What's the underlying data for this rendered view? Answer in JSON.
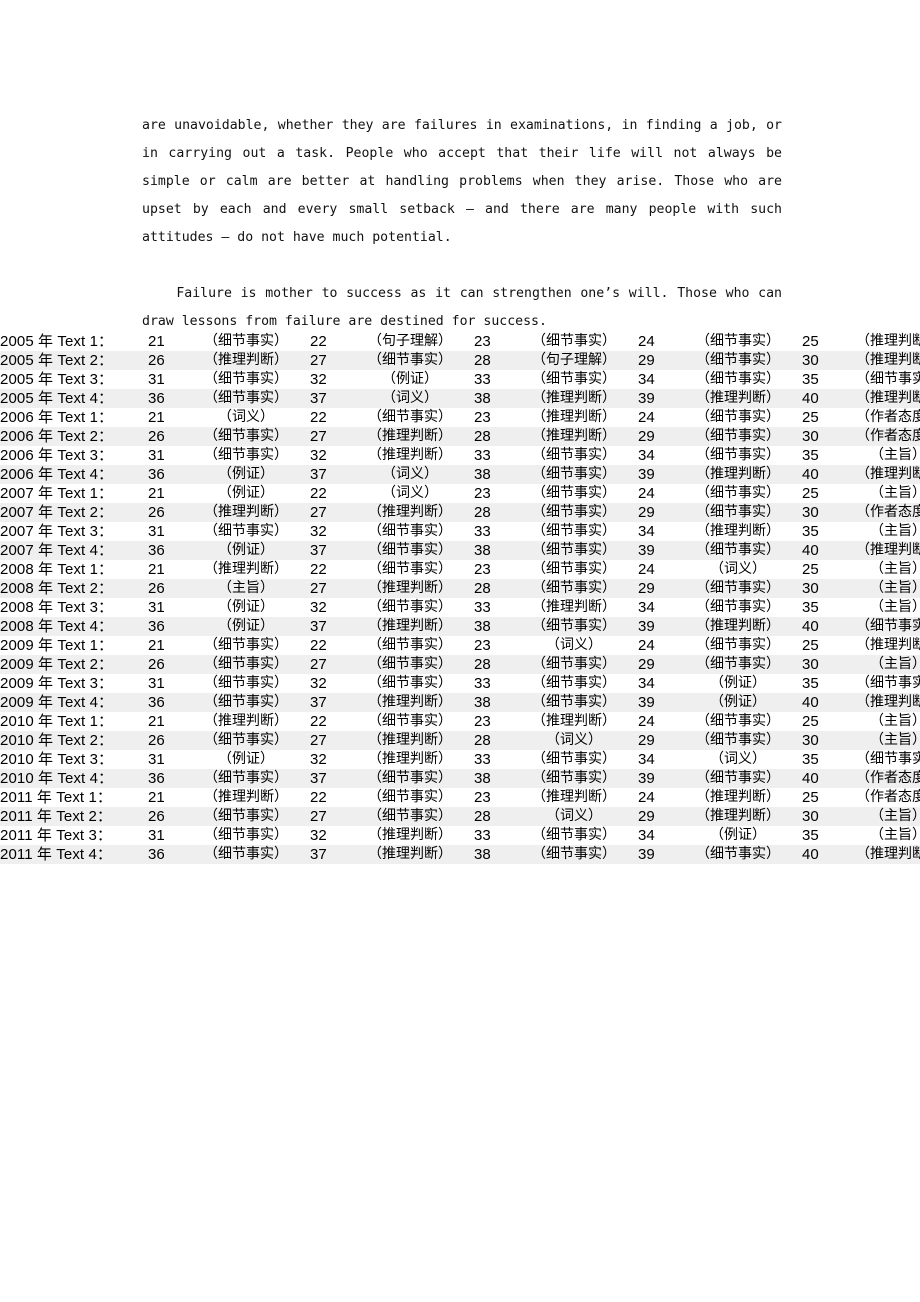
{
  "document": {
    "paragraphs": [
      "are unavoidable, whether they are failures in examinations, in finding a job, or in carrying out a task. People who accept that their life will not always be simple or calm are better at handling problems when they arise. Those who are upset by each and every small setback – and there are many people with such attitudes – do not have much potential.",
      "Failure is mother to success as it can strengthen one’s will. Those who can draw lessons from failure are destined for success."
    ]
  },
  "answer_table": {
    "label_suffix": "：",
    "rows": [
      {
        "label": "2005 年 Text 1：",
        "shaded": false,
        "cells": [
          {
            "num": "21",
            "type": "（细节事实）"
          },
          {
            "num": "22",
            "type": "（句子理解）"
          },
          {
            "num": "23",
            "type": "（细节事实）"
          },
          {
            "num": "24",
            "type": "（细节事实）"
          },
          {
            "num": "25",
            "type": "（推理判断）"
          }
        ]
      },
      {
        "label": "2005 年 Text 2：",
        "shaded": true,
        "cells": [
          {
            "num": "26",
            "type": "（推理判断）"
          },
          {
            "num": "27",
            "type": "（细节事实）"
          },
          {
            "num": "28",
            "type": "（句子理解）"
          },
          {
            "num": "29",
            "type": "（细节事实）"
          },
          {
            "num": "30",
            "type": "（推理判断）"
          }
        ]
      },
      {
        "label": "2005 年 Text 3：",
        "shaded": false,
        "cells": [
          {
            "num": "31",
            "type": "（细节事实）"
          },
          {
            "num": "32",
            "type": "（例证）"
          },
          {
            "num": "33",
            "type": "（细节事实）"
          },
          {
            "num": "34",
            "type": "（细节事实）"
          },
          {
            "num": "35",
            "type": "（细节事实）"
          }
        ]
      },
      {
        "label": "2005 年 Text 4：",
        "shaded": true,
        "cells": [
          {
            "num": "36",
            "type": "（细节事实）"
          },
          {
            "num": "37",
            "type": "（词义）"
          },
          {
            "num": "38",
            "type": "（推理判断）"
          },
          {
            "num": "39",
            "type": "（推理判断）"
          },
          {
            "num": "40",
            "type": "（推理判断）"
          }
        ]
      },
      {
        "label": "2006 年 Text 1：",
        "shaded": false,
        "cells": [
          {
            "num": "21",
            "type": "（词义）"
          },
          {
            "num": "22",
            "type": "（细节事实）"
          },
          {
            "num": "23",
            "type": "（推理判断）"
          },
          {
            "num": "24",
            "type": "（细节事实）"
          },
          {
            "num": "25",
            "type": "（作者态度）"
          }
        ]
      },
      {
        "label": "2006 年 Text 2：",
        "shaded": true,
        "cells": [
          {
            "num": "26",
            "type": "（细节事实）"
          },
          {
            "num": "27",
            "type": "（推理判断）"
          },
          {
            "num": "28",
            "type": "（推理判断）"
          },
          {
            "num": "29",
            "type": "（细节事实）"
          },
          {
            "num": "30",
            "type": "（作者态度）"
          }
        ]
      },
      {
        "label": "2006 年 Text 3：",
        "shaded": false,
        "cells": [
          {
            "num": "31",
            "type": "（细节事实）"
          },
          {
            "num": "32",
            "type": "（推理判断）"
          },
          {
            "num": "33",
            "type": "（细节事实）"
          },
          {
            "num": "34",
            "type": "（细节事实）"
          },
          {
            "num": "35",
            "type": "（主旨）"
          }
        ]
      },
      {
        "label": "2006 年 Text 4：",
        "shaded": true,
        "cells": [
          {
            "num": "36",
            "type": "（例证）"
          },
          {
            "num": "37",
            "type": "（词义）"
          },
          {
            "num": "38",
            "type": "（细节事实）"
          },
          {
            "num": "39",
            "type": "（推理判断）"
          },
          {
            "num": "40",
            "type": "（推理判断）"
          }
        ]
      },
      {
        "label": "2007 年 Text 1：",
        "shaded": false,
        "cells": [
          {
            "num": "21",
            "type": "（例证）"
          },
          {
            "num": "22",
            "type": "（词义）"
          },
          {
            "num": "23",
            "type": "（细节事实）"
          },
          {
            "num": "24",
            "type": "（细节事实）"
          },
          {
            "num": "25",
            "type": "（主旨）"
          }
        ]
      },
      {
        "label": "2007 年 Text 2：",
        "shaded": true,
        "cells": [
          {
            "num": "26",
            "type": "（推理判断）"
          },
          {
            "num": "27",
            "type": "（推理判断）"
          },
          {
            "num": "28",
            "type": "（细节事实）"
          },
          {
            "num": "29",
            "type": "（细节事实）"
          },
          {
            "num": "30",
            "type": "（作者态度）"
          }
        ]
      },
      {
        "label": "2007 年 Text 3：",
        "shaded": false,
        "cells": [
          {
            "num": "31",
            "type": "（细节事实）"
          },
          {
            "num": "32",
            "type": "（细节事实）"
          },
          {
            "num": "33",
            "type": "（细节事实）"
          },
          {
            "num": "34",
            "type": "（推理判断）"
          },
          {
            "num": "35",
            "type": "（主旨）"
          }
        ]
      },
      {
        "label": "2007 年 Text 4：",
        "shaded": true,
        "cells": [
          {
            "num": "36",
            "type": "（例证）"
          },
          {
            "num": "37",
            "type": "（细节事实）"
          },
          {
            "num": "38",
            "type": "（细节事实）"
          },
          {
            "num": "39",
            "type": "（细节事实）"
          },
          {
            "num": "40",
            "type": "（推理判断）"
          }
        ]
      },
      {
        "label": "2008 年 Text 1：",
        "shaded": false,
        "cells": [
          {
            "num": "21",
            "type": "（推理判断）"
          },
          {
            "num": "22",
            "type": "（细节事实）"
          },
          {
            "num": "23",
            "type": "（细节事实）"
          },
          {
            "num": "24",
            "type": "（词义）"
          },
          {
            "num": "25",
            "type": "（主旨）"
          }
        ]
      },
      {
        "label": "2008 年 Text 2：",
        "shaded": true,
        "cells": [
          {
            "num": "26",
            "type": "（主旨）"
          },
          {
            "num": "27",
            "type": "（推理判断）"
          },
          {
            "num": "28",
            "type": "（细节事实）"
          },
          {
            "num": "29",
            "type": "（细节事实）"
          },
          {
            "num": "30",
            "type": "（主旨）"
          }
        ]
      },
      {
        "label": "2008 年 Text 3：",
        "shaded": false,
        "cells": [
          {
            "num": "31",
            "type": "（例证）"
          },
          {
            "num": "32",
            "type": "（细节事实）"
          },
          {
            "num": "33",
            "type": "（推理判断）"
          },
          {
            "num": "34",
            "type": "（细节事实）"
          },
          {
            "num": "35",
            "type": "（主旨）"
          }
        ]
      },
      {
        "label": "2008 年 Text 4：",
        "shaded": true,
        "cells": [
          {
            "num": "36",
            "type": "（例证）"
          },
          {
            "num": "37",
            "type": "（推理判断）"
          },
          {
            "num": "38",
            "type": "（细节事实）"
          },
          {
            "num": "39",
            "type": "（推理判断）"
          },
          {
            "num": "40",
            "type": "（细节事实）"
          }
        ]
      },
      {
        "label": "2009 年 Text 1：",
        "shaded": false,
        "cells": [
          {
            "num": "21",
            "type": "（细节事实）"
          },
          {
            "num": "22",
            "type": "（细节事实）"
          },
          {
            "num": "23",
            "type": "（词义）"
          },
          {
            "num": "24",
            "type": "（细节事实）"
          },
          {
            "num": "25",
            "type": "（推理判断）"
          }
        ]
      },
      {
        "label": "2009 年 Text 2：",
        "shaded": true,
        "cells": [
          {
            "num": "26",
            "type": "（细节事实）"
          },
          {
            "num": "27",
            "type": "（细节事实）"
          },
          {
            "num": "28",
            "type": "（细节事实）"
          },
          {
            "num": "29",
            "type": "（细节事实）"
          },
          {
            "num": "30",
            "type": "（主旨）"
          }
        ]
      },
      {
        "label": "2009 年 Text 3：",
        "shaded": false,
        "cells": [
          {
            "num": "31",
            "type": "（细节事实）"
          },
          {
            "num": "32",
            "type": "（细节事实）"
          },
          {
            "num": "33",
            "type": "（细节事实）"
          },
          {
            "num": "34",
            "type": "（例证）"
          },
          {
            "num": "35",
            "type": "（细节事实）"
          }
        ]
      },
      {
        "label": "2009 年 Text 4：",
        "shaded": true,
        "cells": [
          {
            "num": "36",
            "type": "（细节事实）"
          },
          {
            "num": "37",
            "type": "（推理判断）"
          },
          {
            "num": "38",
            "type": "（细节事实）"
          },
          {
            "num": "39",
            "type": "（例证）"
          },
          {
            "num": "40",
            "type": "（推理判断）"
          }
        ]
      },
      {
        "label": "2010 年 Text 1：",
        "shaded": false,
        "cells": [
          {
            "num": "21",
            "type": "（推理判断）"
          },
          {
            "num": "22",
            "type": "（细节事实）"
          },
          {
            "num": "23",
            "type": "（推理判断）"
          },
          {
            "num": "24",
            "type": "（细节事实）"
          },
          {
            "num": "25",
            "type": "（主旨）"
          }
        ]
      },
      {
        "label": "2010 年 Text 2：",
        "shaded": true,
        "cells": [
          {
            "num": "26",
            "type": "（细节事实）"
          },
          {
            "num": "27",
            "type": "（推理判断）"
          },
          {
            "num": "28",
            "type": "（词义）"
          },
          {
            "num": "29",
            "type": "（细节事实）"
          },
          {
            "num": "30",
            "type": "（主旨）"
          }
        ]
      },
      {
        "label": "2010 年 Text 3：",
        "shaded": false,
        "cells": [
          {
            "num": "31",
            "type": "（例证）"
          },
          {
            "num": "32",
            "type": "（推理判断）"
          },
          {
            "num": "33",
            "type": "（细节事实）"
          },
          {
            "num": "34",
            "type": "（词义）"
          },
          {
            "num": "35",
            "type": "（细节事实）"
          }
        ]
      },
      {
        "label": "2010 年 Text 4：",
        "shaded": true,
        "cells": [
          {
            "num": "36",
            "type": "（细节事实）"
          },
          {
            "num": "37",
            "type": "（细节事实）"
          },
          {
            "num": "38",
            "type": "（细节事实）"
          },
          {
            "num": "39",
            "type": "（细节事实）"
          },
          {
            "num": "40",
            "type": "（作者态度）"
          }
        ]
      },
      {
        "label": "2011 年 Text 1：",
        "shaded": false,
        "cells": [
          {
            "num": "21",
            "type": "（推理判断）"
          },
          {
            "num": "22",
            "type": "（细节事实）"
          },
          {
            "num": "23",
            "type": "（推理判断）"
          },
          {
            "num": "24",
            "type": "（推理判断）"
          },
          {
            "num": "25",
            "type": "（作者态度）"
          }
        ]
      },
      {
        "label": "2011 年 Text 2：",
        "shaded": true,
        "cells": [
          {
            "num": "26",
            "type": "（细节事实）"
          },
          {
            "num": "27",
            "type": "（细节事实）"
          },
          {
            "num": "28",
            "type": "（词义）"
          },
          {
            "num": "29",
            "type": "（推理判断）"
          },
          {
            "num": "30",
            "type": "（主旨）"
          }
        ]
      },
      {
        "label": "2011 年 Text 3：",
        "shaded": false,
        "cells": [
          {
            "num": "31",
            "type": "（细节事实）"
          },
          {
            "num": "32",
            "type": "（推理判断）"
          },
          {
            "num": "33",
            "type": "（细节事实）"
          },
          {
            "num": "34",
            "type": "（例证）"
          },
          {
            "num": "35",
            "type": "（主旨）"
          }
        ]
      },
      {
        "label": "2011 年 Text 4：",
        "shaded": true,
        "cells": [
          {
            "num": "36",
            "type": "（细节事实）"
          },
          {
            "num": "37",
            "type": "（推理判断）"
          },
          {
            "num": "38",
            "type": "（细节事实）"
          },
          {
            "num": "39",
            "type": "（细节事实）"
          },
          {
            "num": "40",
            "type": "（推理判断）"
          }
        ]
      }
    ]
  },
  "colors": {
    "page_background": "#ffffff",
    "text": "#000000",
    "row_shade": "#efefef"
  }
}
